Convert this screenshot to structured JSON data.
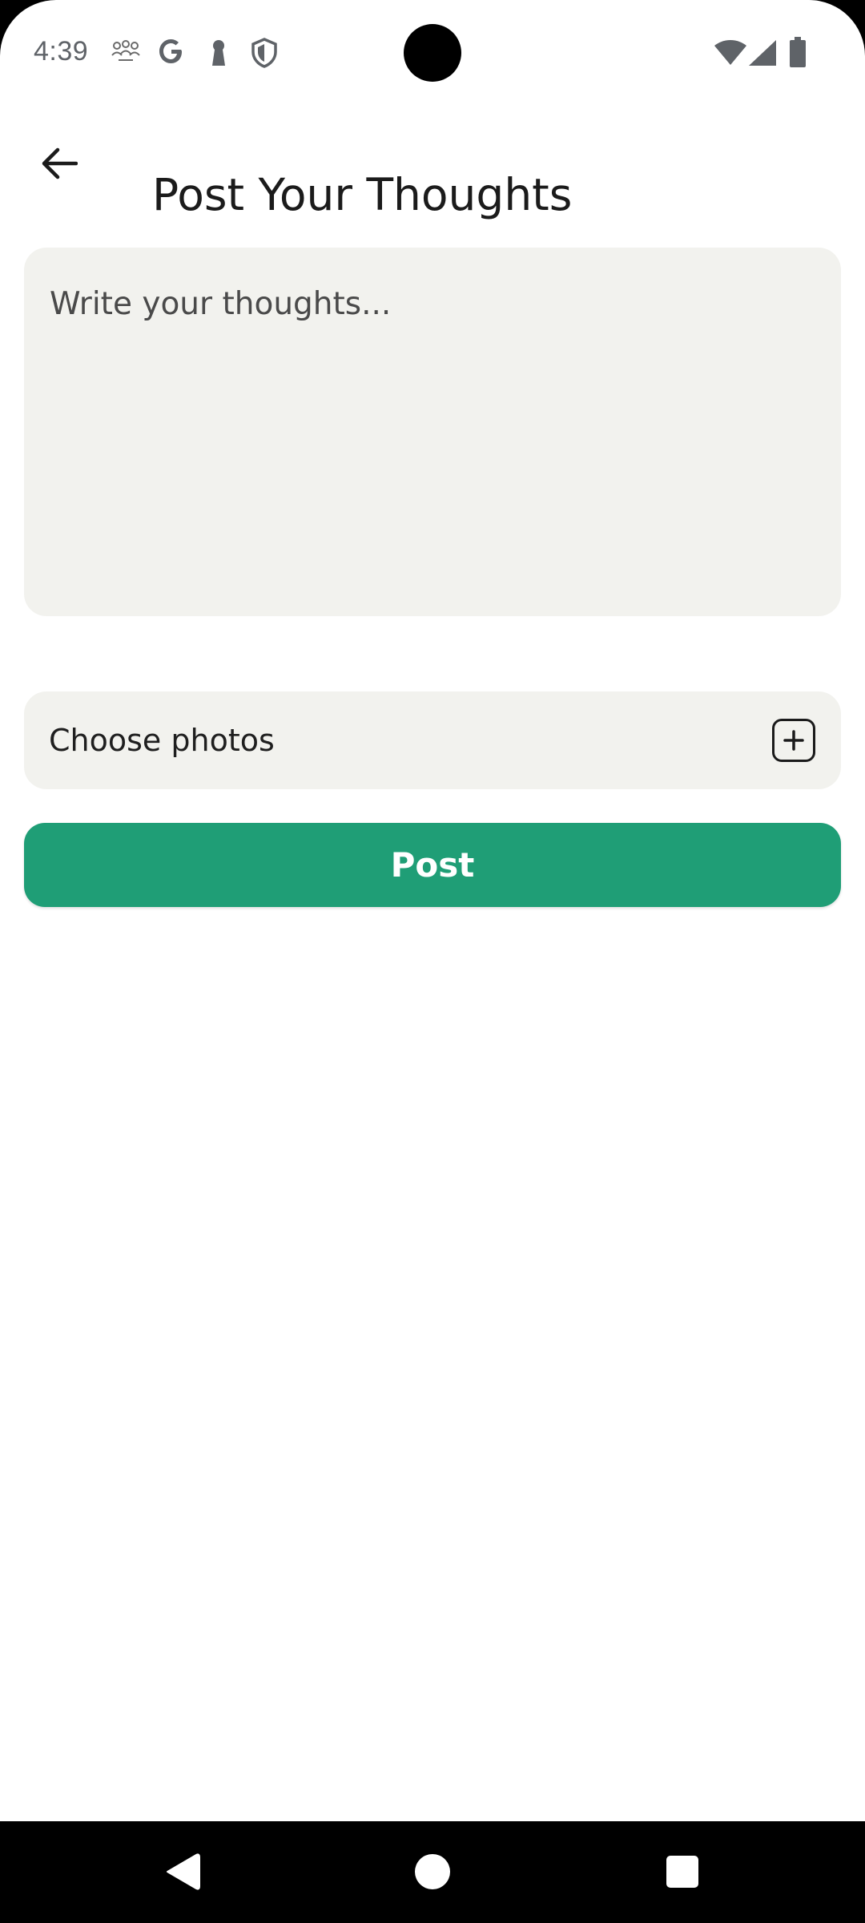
{
  "status_bar": {
    "time": "4:39",
    "icons": [
      "community-icon",
      "google-icon",
      "keyhole-icon",
      "shield-icon"
    ],
    "right_icons": [
      "wifi-icon",
      "cell-signal-icon",
      "battery-icon"
    ]
  },
  "header": {
    "back_icon": "arrow-left-icon",
    "title": "Post Your Thoughts"
  },
  "composer": {
    "placeholder": "Write your thoughts..."
  },
  "photos": {
    "label": "Choose photos",
    "icon": "plus-square-icon"
  },
  "post_button": {
    "label": "Post",
    "color": "#1f9e76"
  },
  "nav_bar": {
    "buttons": [
      "back-triangle-icon",
      "home-circle-icon",
      "recents-square-icon"
    ]
  },
  "colors": {
    "field_background": "#f2f2ee",
    "accent": "#1f9e76",
    "text": "#1b1b1b"
  }
}
